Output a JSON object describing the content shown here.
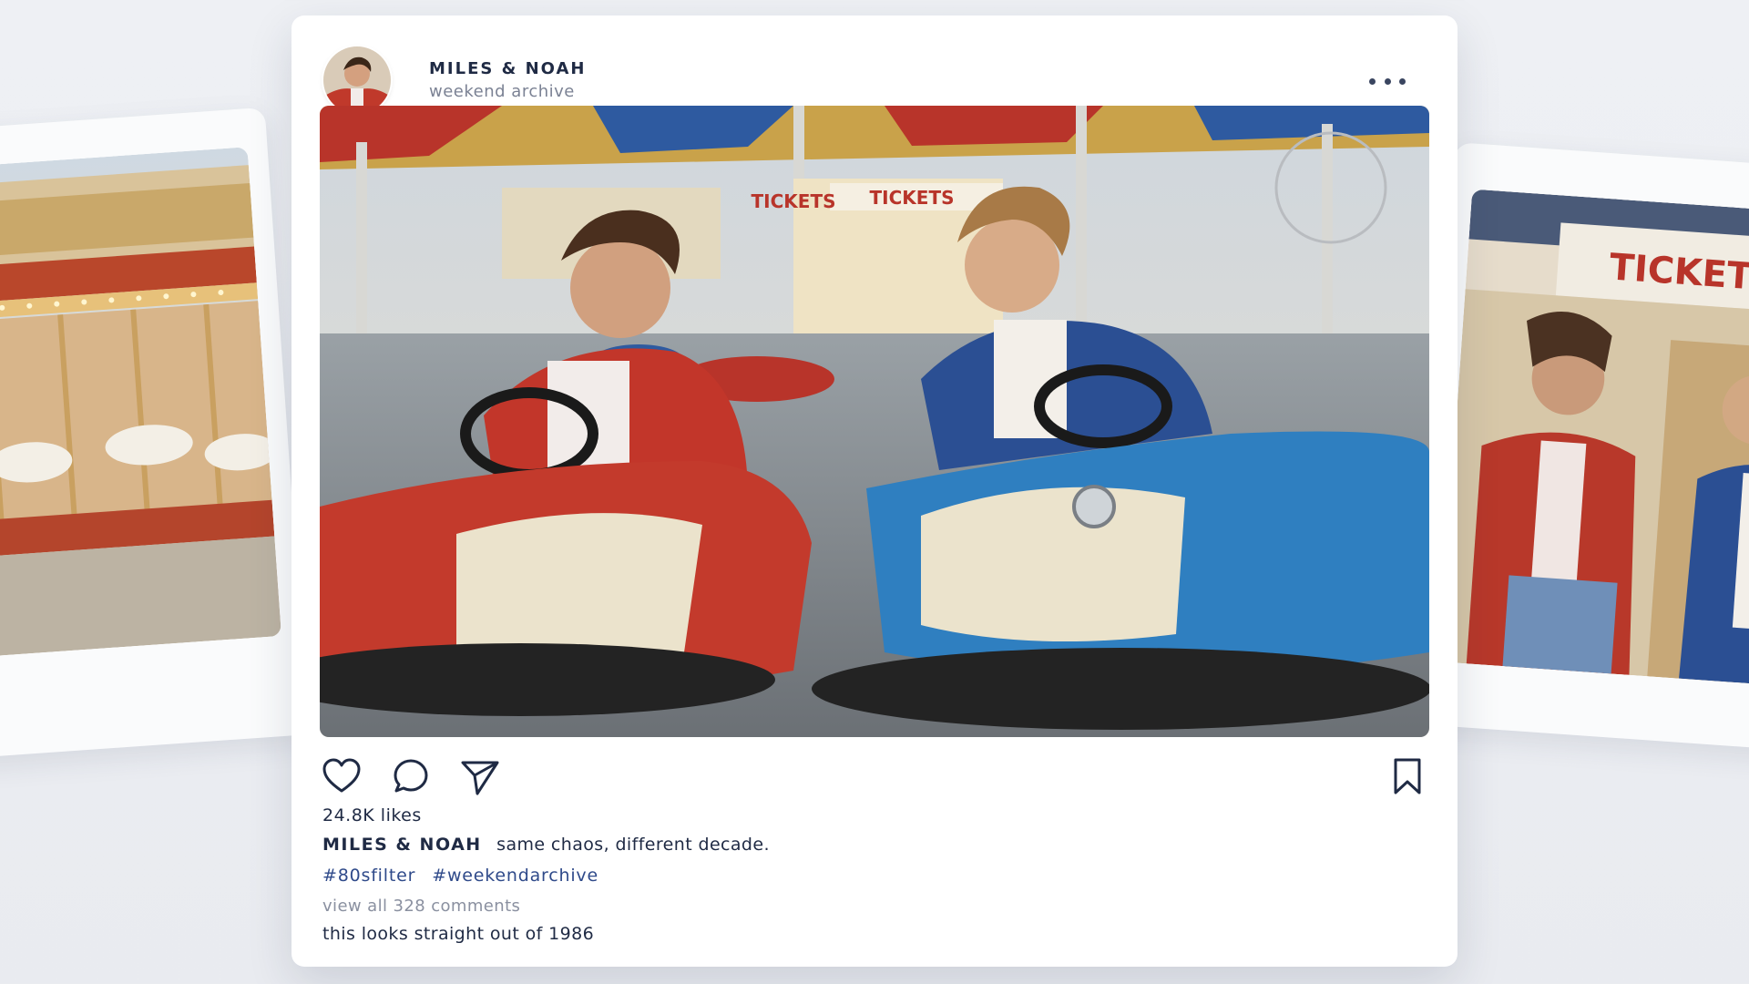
{
  "post": {
    "account_name": "MILES & NOAH",
    "account_subtitle": "weekend archive",
    "likes_text": "24.8K likes",
    "caption_user": "MILES & NOAH",
    "caption_text": "same chaos, different decade.",
    "hashtags": [
      "#80sfilter",
      "#weekendarchive"
    ],
    "view_comments": "view all 328 comments",
    "comment_text": "this looks straight out of 1986",
    "main_photo_sign_1": "TICKETS",
    "main_photo_sign_2": "TICKETS"
  },
  "right_card": {
    "sign_text": "TICKETS"
  },
  "icons": [
    "more-icon",
    "heart-icon",
    "comment-icon",
    "send-icon",
    "bookmark-icon"
  ],
  "colors": {
    "background": "#eceef2",
    "hashtag": "#2f4a8a",
    "text": "#1f2a44",
    "muted": "#8a90a0"
  }
}
